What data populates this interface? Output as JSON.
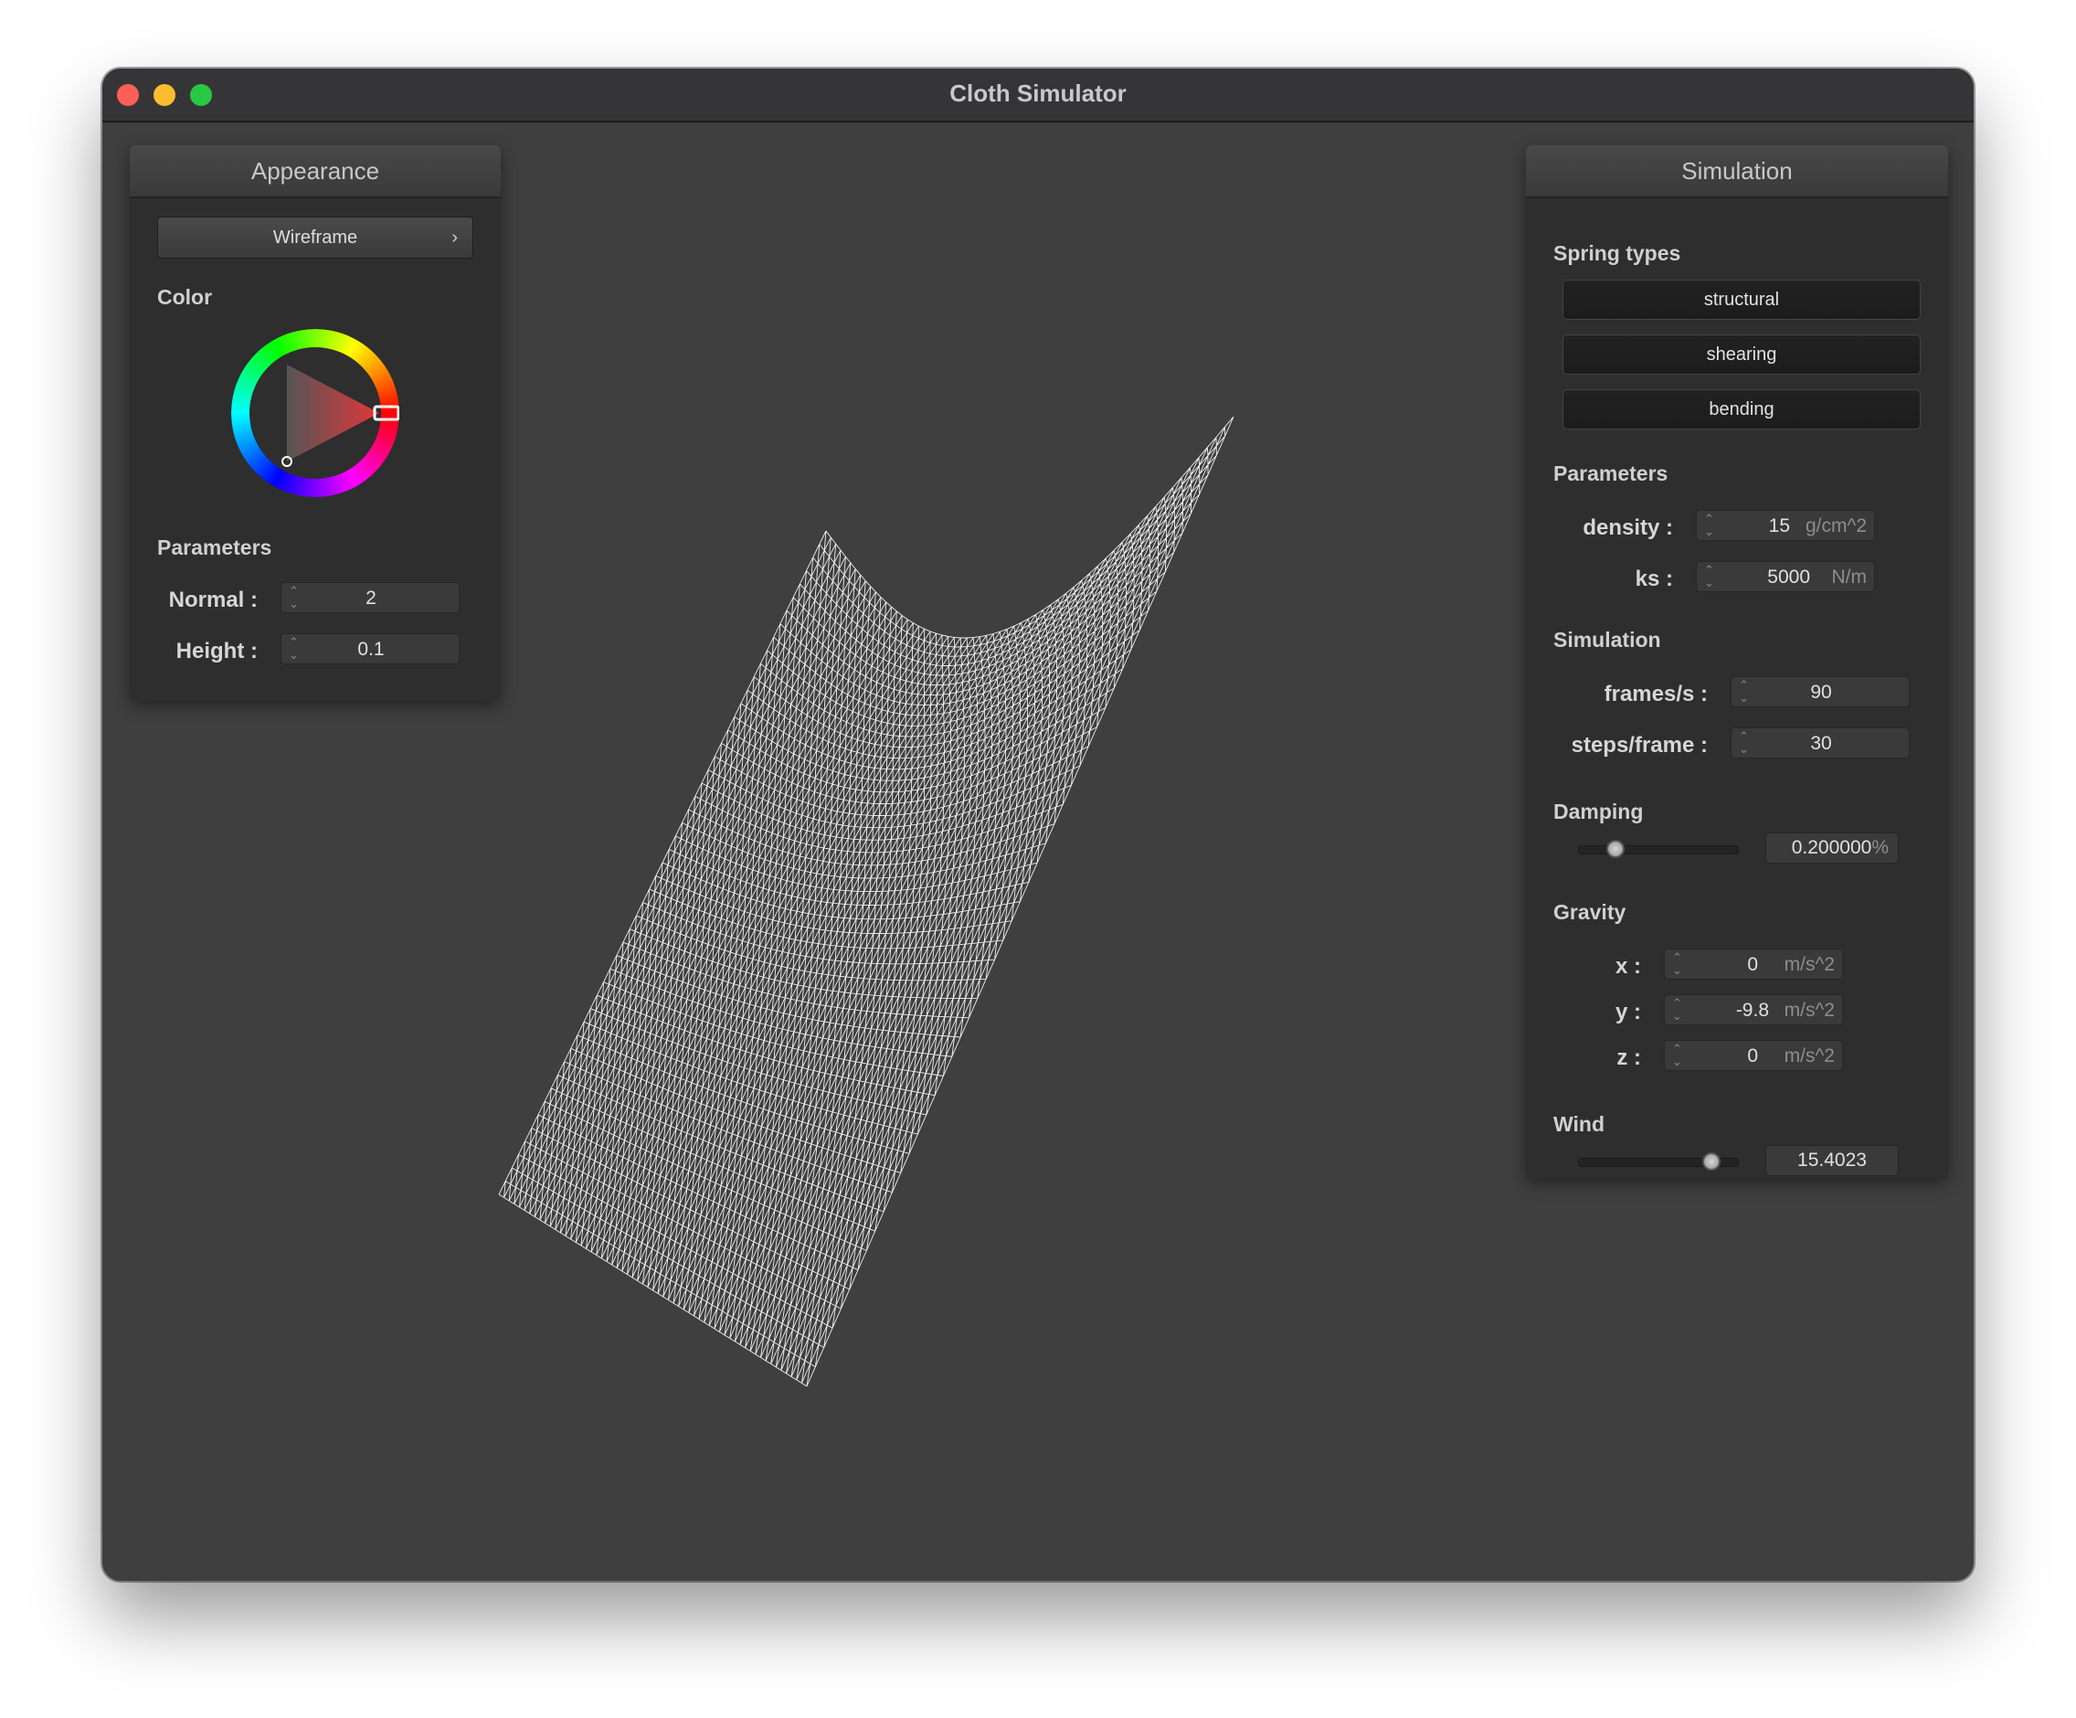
{
  "window": {
    "title": "Cloth Simulator"
  },
  "appearance": {
    "header": "Appearance",
    "shader": "Wireframe",
    "color_label": "Color",
    "color_value": "#e0373a",
    "parameters_label": "Parameters",
    "normal": {
      "label": "Normal :",
      "value": "2"
    },
    "height": {
      "label": "Height :",
      "value": "0.1"
    }
  },
  "simulation": {
    "header": "Simulation",
    "spring_types_label": "Spring types",
    "springs": [
      "structural",
      "shearing",
      "bending"
    ],
    "parameters_label": "Parameters",
    "density": {
      "label": "density :",
      "value": "15",
      "unit": "g/cm^2"
    },
    "ks": {
      "label": "ks :",
      "value": "5000",
      "unit": "N/m"
    },
    "simulation_label": "Simulation",
    "fps": {
      "label": "frames/s :",
      "value": "90"
    },
    "steps": {
      "label": "steps/frame :",
      "value": "30"
    },
    "damping": {
      "label": "Damping",
      "value": "0.200000",
      "unit": "%",
      "slider_fraction": 0.2
    },
    "gravity": {
      "label": "Gravity",
      "x": {
        "label": "x :",
        "value": "0",
        "unit": "m/s^2"
      },
      "y": {
        "label": "y :",
        "value": "-9.8",
        "unit": "m/s^2"
      },
      "z": {
        "label": "z :",
        "value": "0",
        "unit": "m/s^2"
      }
    },
    "wind": {
      "label": "Wind",
      "value": "15.4023",
      "slider_fraction": 0.88
    }
  }
}
